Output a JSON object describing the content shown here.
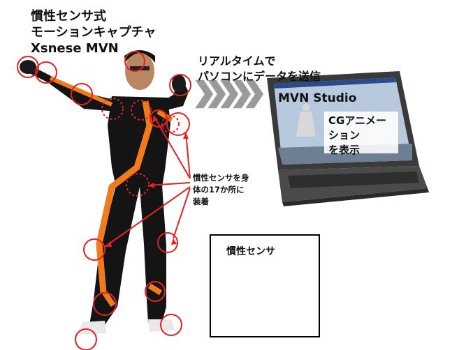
{
  "title": {
    "line1": "慣性センサ式",
    "line2": "モーションキャプチャ",
    "line3": "Xsnese  MVN"
  },
  "realtime_label": {
    "line1": "リアルタイムで",
    "line2": "パソコンにデータを送信"
  },
  "screen": {
    "title": "MVN  Studio",
    "cg_line1": "CGアニメーション",
    "cg_line2": "を表示"
  },
  "sensor_note": {
    "line1": "慣性センサを身",
    "line2": "体の17か所に",
    "line3": "装着"
  },
  "sensor_box": {
    "label": "慣性センサ"
  },
  "colors": {
    "marker_red": "#e52222",
    "suit_black": "#141414",
    "suit_orange": "#f07a1e",
    "sensor_orange": "#e8652a",
    "chevron_gray": "#9a9a9a",
    "screen_sky": "#b9c9dd"
  }
}
